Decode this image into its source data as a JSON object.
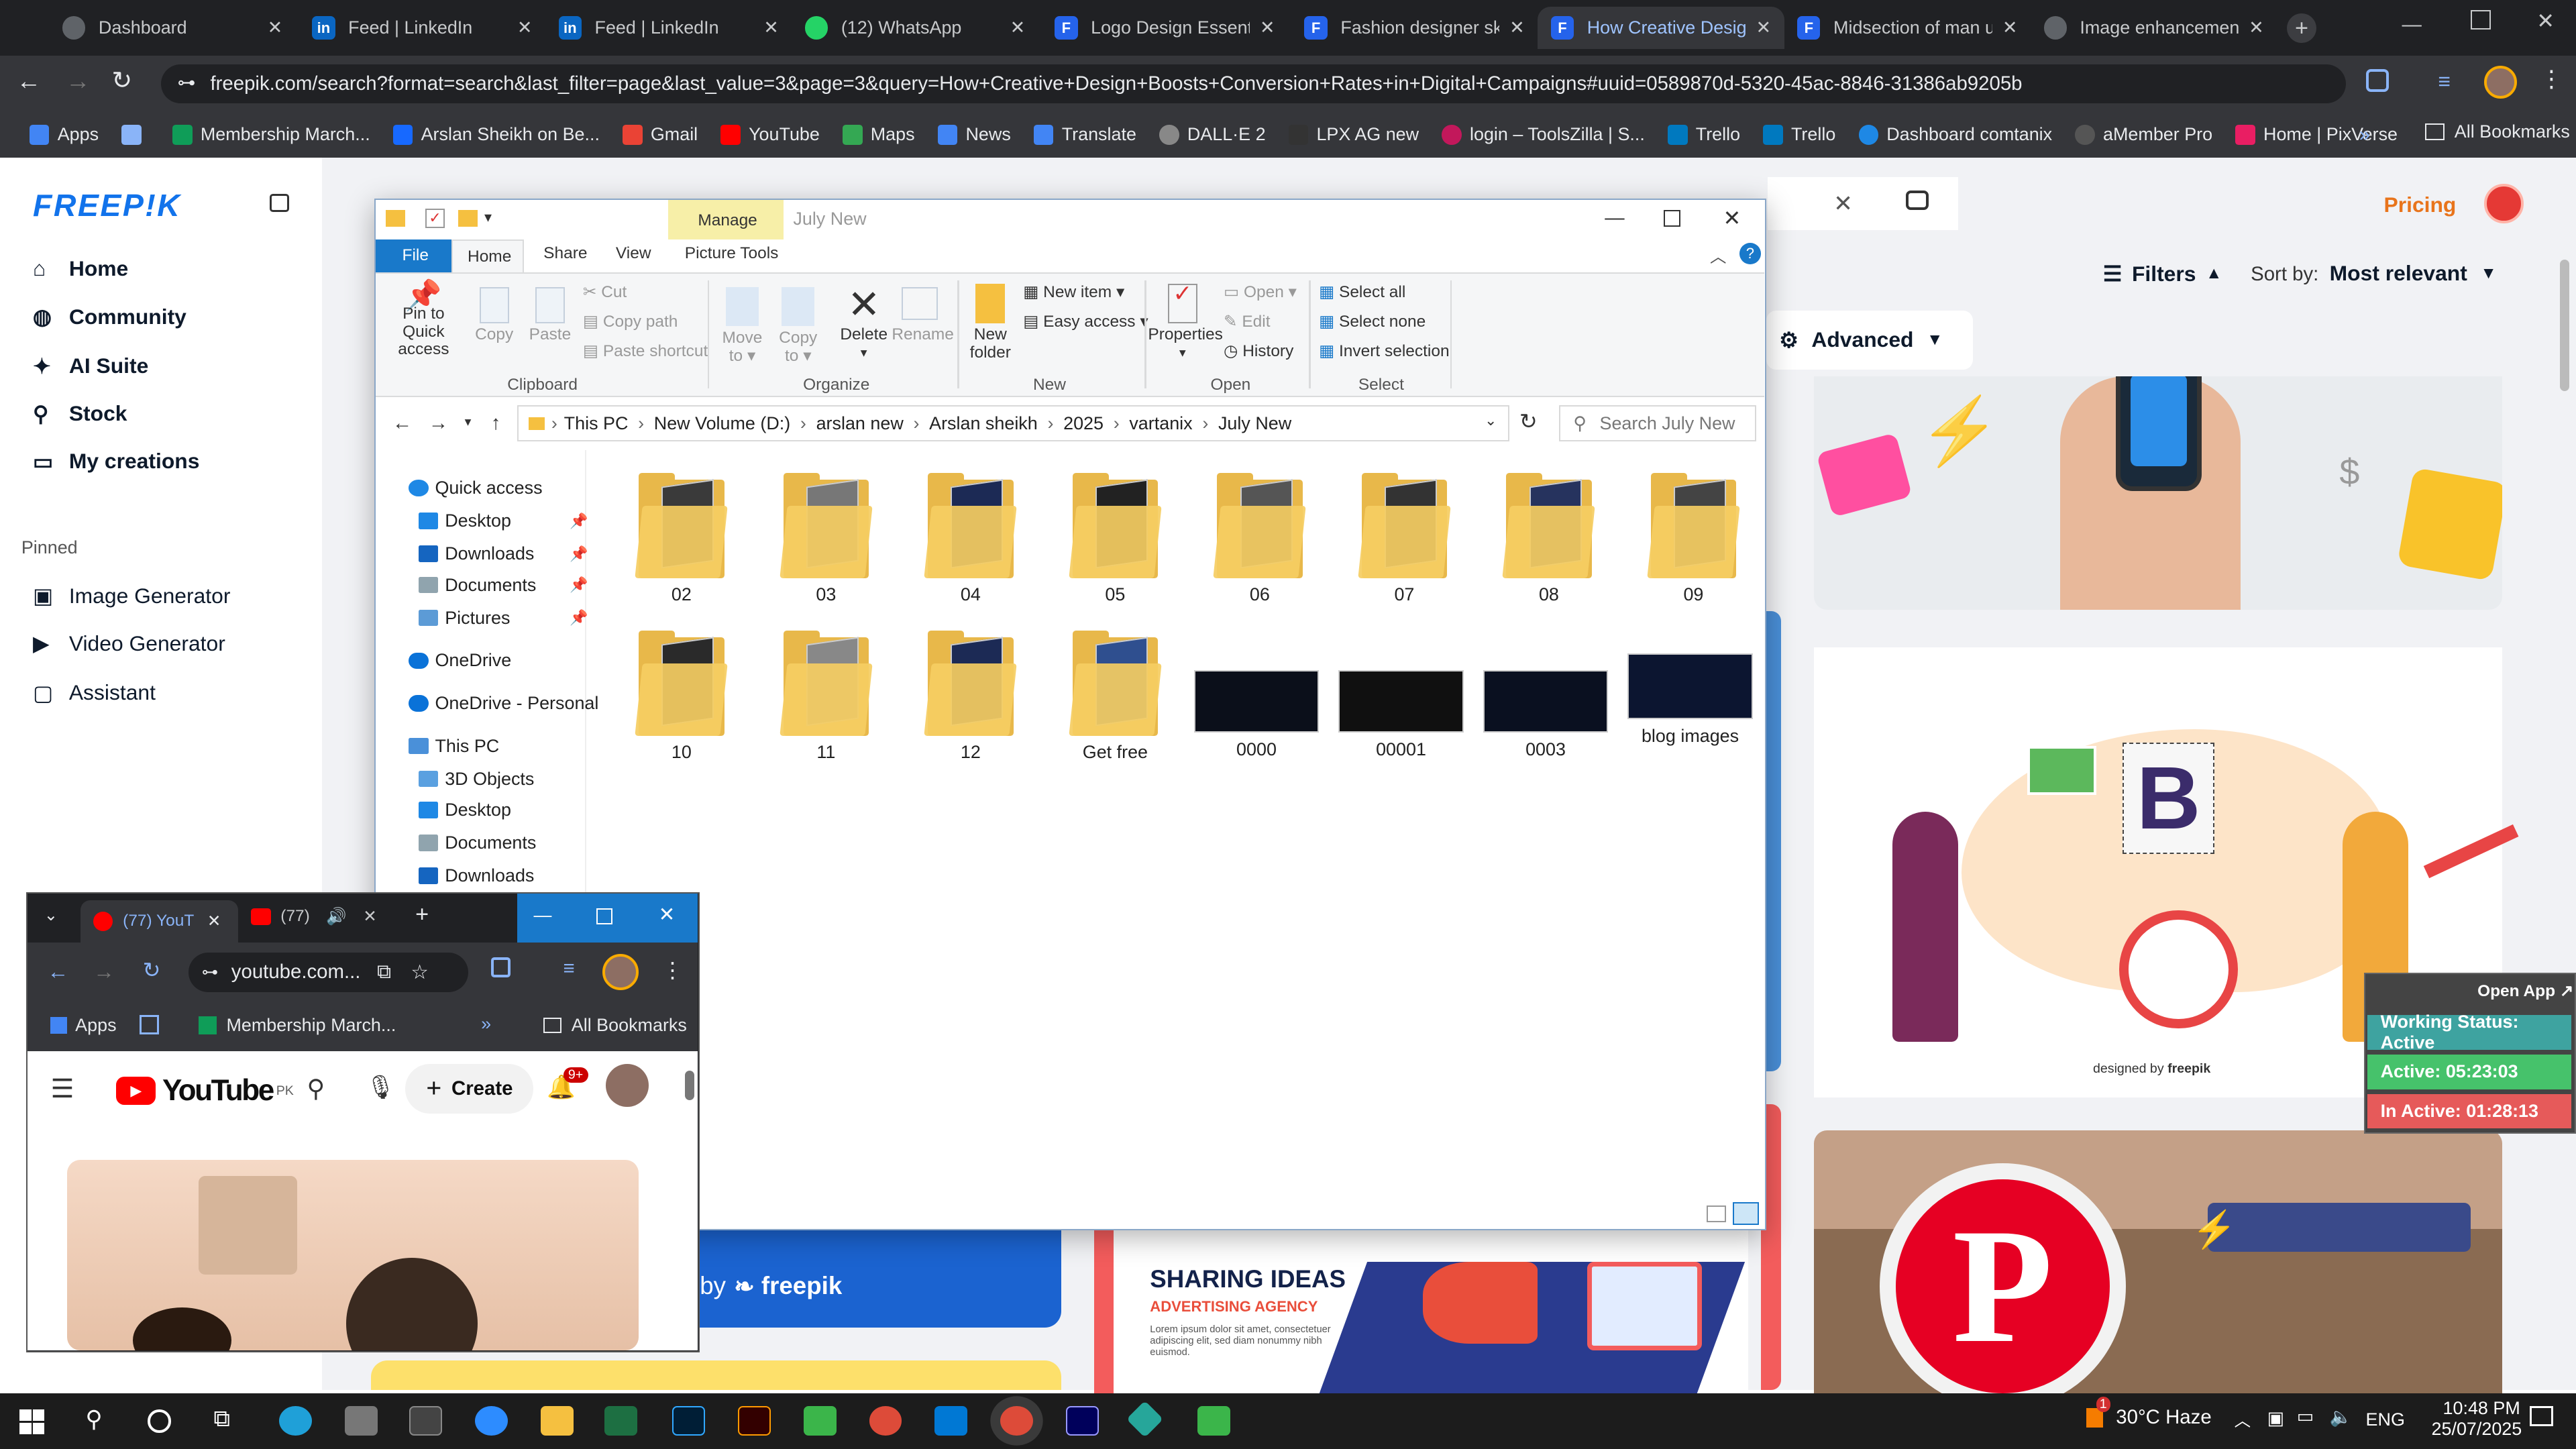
{
  "chrome": {
    "tabs": [
      {
        "title": "Dashboard",
        "fav": "#5f6368",
        "active": false
      },
      {
        "title": "Feed | LinkedIn",
        "fav": "#0a66c2",
        "active": false
      },
      {
        "title": "Feed | LinkedIn",
        "fav": "#0a66c2",
        "active": false
      },
      {
        "title": "(12) WhatsApp",
        "fav": "#25d366",
        "active": false
      },
      {
        "title": "Logo Design Essentia",
        "fav": "#2563eb",
        "active": false
      },
      {
        "title": "Fashion designer sk",
        "fav": "#2563eb",
        "active": false
      },
      {
        "title": "How Creative Design",
        "fav": "#2563eb",
        "active": true
      },
      {
        "title": "Midsection of man u",
        "fav": "#2563eb",
        "active": false
      },
      {
        "title": "Image enhancement",
        "fav": "#5f6368",
        "active": false
      }
    ],
    "url": "freepik.com/search?format=search&last_filter=page&last_value=3&page=3&query=How+Creative+Design+Boosts+Conversion+Rates+in+Digital+Campaigns#uuid=0589870d-5320-45ac-8846-31386ab9205b",
    "bookmarks": [
      {
        "label": "Apps",
        "color": "#4285f4"
      },
      {
        "label": "Membership March...",
        "color": "#0f9d58"
      },
      {
        "label": "Arslan Sheikh on Be...",
        "color": "#1769ff"
      },
      {
        "label": "Gmail",
        "color": "#ea4335"
      },
      {
        "label": "YouTube",
        "color": "#ff0000"
      },
      {
        "label": "Maps",
        "color": "#34a853"
      },
      {
        "label": "News",
        "color": "#4285f4"
      },
      {
        "label": "Translate",
        "color": "#4285f4"
      },
      {
        "label": "DALL·E 2",
        "color": "#888888"
      },
      {
        "label": "LPX AG new",
        "color": "#333333"
      },
      {
        "label": "login – ToolsZilla | S...",
        "color": "#c2185b"
      },
      {
        "label": "Trello",
        "color": "#0079bf"
      },
      {
        "label": "Trello",
        "color": "#0079bf"
      },
      {
        "label": "Dashboard comtanix",
        "color": "#1e88e5"
      },
      {
        "label": "aMember Pro",
        "color": "#555555"
      },
      {
        "label": "Home | PixVerse",
        "color": "#e91e63"
      }
    ],
    "all_bookmarks": "All Bookmarks"
  },
  "freepik": {
    "logo": "FREEP!K",
    "nav": [
      {
        "label": "Home",
        "icon": "home-icon"
      },
      {
        "label": "Community",
        "icon": "globe-icon"
      },
      {
        "label": "AI Suite",
        "icon": "sparkle-icon"
      },
      {
        "label": "Stock",
        "icon": "search-icon"
      },
      {
        "label": "My creations",
        "icon": "folder-icon"
      }
    ],
    "pinned_title": "Pinned",
    "pinned": [
      {
        "label": "Image Generator",
        "icon": "image-icon"
      },
      {
        "label": "Video Generator",
        "icon": "video-icon"
      },
      {
        "label": "Assistant",
        "icon": "chat-icon"
      }
    ],
    "pricing": "Pricing",
    "filters": "Filters",
    "sort_by": "Sort by:",
    "sort_value": "Most relevant",
    "advanced": "Advanced",
    "designed_by": "designed by",
    "freepik_word": "freepik",
    "sharing_title": "SHARING IDEAS",
    "sharing_sub": "ADVERTISING AGENCY",
    "sharing_body": "Lorem ipsum dolor sit amet, consectetuer adipiscing elit, sed diam nonummy nibh euismod.",
    "banner_by": "by",
    "banner_brand": "freepik",
    "open_app": "Open App",
    "status": {
      "working": "Working Status: Active",
      "active": "Active: 05:23:03",
      "inactive": "In Active: 01:28:13"
    }
  },
  "explorer": {
    "manage": "Manage",
    "title": "July New",
    "ribbon_tabs": [
      "File",
      "Home",
      "Share",
      "View",
      "Picture Tools"
    ],
    "clipboard": {
      "pin": "Pin to Quick access",
      "copy": "Copy",
      "paste": "Paste",
      "cut": "Cut",
      "copy_path": "Copy path",
      "paste_shortcut": "Paste shortcut",
      "group": "Clipboard"
    },
    "organize": {
      "move": "Move to",
      "copy": "Copy to",
      "delete": "Delete",
      "rename": "Rename",
      "group": "Organize"
    },
    "new": {
      "folder": "New folder",
      "item": "New item",
      "easy": "Easy access",
      "group": "New"
    },
    "open": {
      "properties": "Properties",
      "open": "Open",
      "edit": "Edit",
      "history": "History",
      "group": "Open"
    },
    "select": {
      "all": "Select all",
      "none": "Select none",
      "invert": "Invert selection",
      "group": "Select"
    },
    "breadcrumb": [
      "This PC",
      "New Volume (D:)",
      "arslan new",
      "Arslan sheikh",
      "2025",
      "vartanix",
      "July New"
    ],
    "search_placeholder": "Search July New",
    "nav": [
      {
        "label": "Quick access",
        "color": "#1e88e5",
        "pinned": false
      },
      {
        "label": "Desktop",
        "color": "#1e88e5",
        "pinned": true
      },
      {
        "label": "Downloads",
        "color": "#1565c0",
        "pinned": true
      },
      {
        "label": "Documents",
        "color": "#90a4ae",
        "pinned": true
      },
      {
        "label": "Pictures",
        "color": "#5c9bd6",
        "pinned": true
      },
      {
        "label": "OneDrive",
        "color": "#0a72d8",
        "pinned": false
      },
      {
        "label": "OneDrive - Personal",
        "color": "#0a72d8",
        "pinned": false
      },
      {
        "label": "This PC",
        "color": "#4a90d9",
        "pinned": false
      },
      {
        "label": "3D Objects",
        "color": "#5aa0e0",
        "pinned": false
      },
      {
        "label": "Desktop",
        "color": "#1e88e5",
        "pinned": false
      },
      {
        "label": "Documents",
        "color": "#90a4ae",
        "pinned": false
      },
      {
        "label": "Downloads",
        "color": "#1565c0",
        "pinned": false
      }
    ],
    "folders": [
      "02",
      "03",
      "04",
      "05",
      "06",
      "07",
      "08",
      "09",
      "10",
      "11",
      "12",
      "Get free"
    ],
    "images": [
      "0000",
      "00001",
      "0003",
      "blog images"
    ]
  },
  "youtube_window": {
    "tabs": [
      "(77) YouT",
      "(77)"
    ],
    "url": "youtube.com...",
    "apps": "Apps",
    "membership": "Membership March...",
    "all_bookmarks": "All Bookmarks",
    "logo": "YouTube",
    "region": "PK",
    "create": "Create",
    "notifications": "9+"
  },
  "taskbar": {
    "weather_temp": "30°C",
    "weather_text": "Haze",
    "weather_badge": "1",
    "language": "ENG",
    "time": "10:48 PM",
    "date": "25/07/2025",
    "apps": [
      {
        "name": "edge",
        "color": "#1fa0d8"
      },
      {
        "name": "pen",
        "color": "#777777"
      },
      {
        "name": "terminal",
        "color": "#444444"
      },
      {
        "name": "zoom",
        "color": "#2d8cff"
      },
      {
        "name": "file-explorer",
        "color": "#f5c040"
      },
      {
        "name": "excel",
        "color": "#1d6f42"
      },
      {
        "name": "photoshop",
        "color": "#31a8ff"
      },
      {
        "name": "illustrator",
        "color": "#ff9a00"
      },
      {
        "name": "green-app",
        "color": "#3bb54a"
      },
      {
        "name": "chrome",
        "color": "#dd4b39"
      },
      {
        "name": "vscode",
        "color": "#0078d4"
      },
      {
        "name": "chrome-active",
        "color": "#dd4b39"
      },
      {
        "name": "premiere",
        "color": "#9999ff"
      },
      {
        "name": "teal-app",
        "color": "#26a69a"
      },
      {
        "name": "green-app-2",
        "color": "#3bb54a"
      }
    ]
  }
}
